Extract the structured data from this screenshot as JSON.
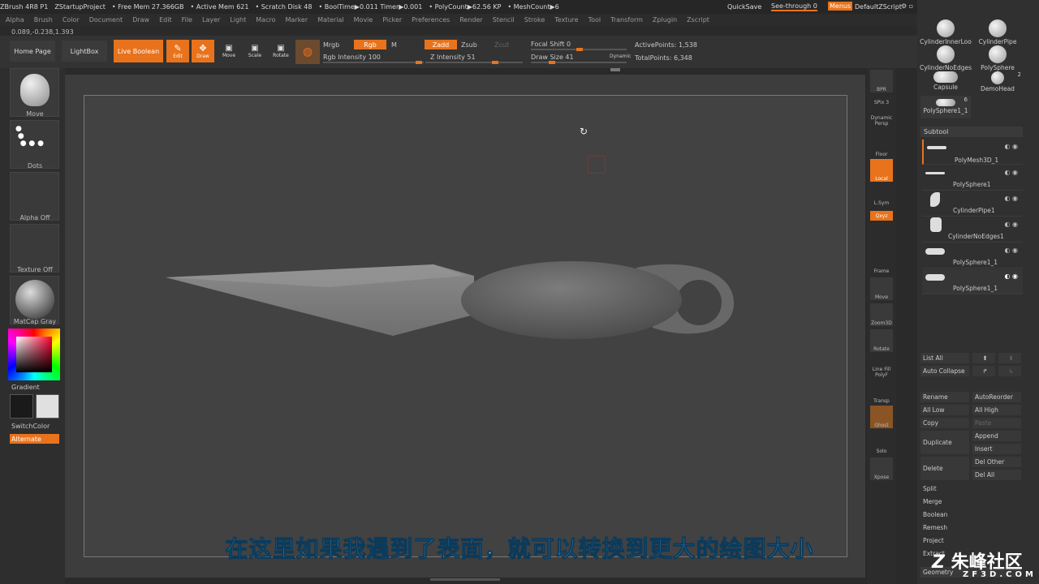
{
  "titlebar": {
    "items": [
      "ZBrush 4R8 P1",
      "ZStartupProject",
      "• Free Mem 27.366GB",
      "• Active Mem 621",
      "• Scratch Disk 48",
      "• BoolTime▶0.011 Timer▶0.001",
      "• PolyCount▶62.56 KP",
      "• MeshCount▶6"
    ],
    "quicksave": "QuickSave",
    "see_through": "See-through  0",
    "menus": "Menus",
    "script": "DefaultZScript"
  },
  "menubar": [
    "Alpha",
    "Brush",
    "Color",
    "Document",
    "Draw",
    "Edit",
    "File",
    "Layer",
    "Light",
    "Macro",
    "Marker",
    "Material",
    "Movie",
    "Picker",
    "Preferences",
    "Render",
    "Stencil",
    "Stroke",
    "Texture",
    "Tool",
    "Transform",
    "Zplugin",
    "Zscript"
  ],
  "coords": "0.089,-0.238,1.393",
  "toolbar": {
    "home": "Home Page",
    "lightbox": "LightBox",
    "live_boolean": "Live Boolean",
    "edit": "Edit",
    "draw": "Draw",
    "move": "Move",
    "scale": "Scale",
    "rotate": "Rotate",
    "mrgb": "Mrgb",
    "rgb": "Rgb",
    "m": "M",
    "rgb_intensity_label": "Rgb Intensity",
    "rgb_intensity": "100",
    "zadd": "Zadd",
    "zsub": "Zsub",
    "zcut": "Zcut",
    "z_intensity_label": "Z Intensity",
    "z_intensity": "51",
    "focal_shift_label": "Focal Shift",
    "focal_shift": "0",
    "draw_size_label": "Draw Size",
    "draw_size": "41",
    "dynamic": "Dynamic",
    "active_points": "ActivePoints: 1,538",
    "total_points": "TotalPoints: 6,348"
  },
  "left": {
    "brush": "Move",
    "stroke": "Dots",
    "alpha": "Alpha Off",
    "texture": "Texture Off",
    "material": "MatCap Gray",
    "gradient": "Gradient",
    "switchcolor": "SwitchColor",
    "alternate": "Alternate"
  },
  "shelf": [
    "BPR",
    "SPix 3",
    "Dynamic Persp",
    "Floor",
    "Local",
    "L.Sym",
    "Qxyz",
    "Frame",
    "Move",
    "Zoom3D",
    "Rotate",
    "Line Fill PolyF",
    "Transp",
    "Ghost",
    "Solo",
    "Xpose"
  ],
  "tools": [
    {
      "name": "CylinderInnerLoo"
    },
    {
      "name": "CylinderPipe"
    },
    {
      "name": "CylinderNoEdges"
    },
    {
      "name": "PolySphere"
    },
    {
      "name": "Capsule"
    },
    {
      "name": "DemoHead",
      "count": "2"
    },
    {
      "name": "PolySphere1_1",
      "count": "6"
    }
  ],
  "subtool_header": "Subtool",
  "subtools": [
    "PolyMesh3D_1",
    "PolySphere1",
    "CylinderPipe1",
    "CylinderNoEdges1",
    "PolySphere1_1",
    "PolySphere1_1"
  ],
  "subtool_actions": {
    "list_all": "List All",
    "auto_collapse": "Auto Collapse",
    "rename": "Rename",
    "auto_reorder": "AutoReorder",
    "all_low": "All Low",
    "all_high": "All High",
    "copy": "Copy",
    "paste": "Paste",
    "duplicate": "Duplicate",
    "append": "Append",
    "insert": "Insert",
    "delete": "Delete",
    "del_other": "Del Other",
    "del_all": "Del All",
    "split": "Split",
    "merge": "Merge",
    "boolean": "Boolean",
    "remesh": "Remesh",
    "project": "Project",
    "extract": "Extract",
    "geometry": "Geometry"
  },
  "subtitle": "在这里如果我遇到了表面，就可以转换到更大的绘图大小",
  "logo": {
    "brand": "朱峰社区",
    "site": "ZF3D.COM"
  },
  "colors": {
    "accent": "#e8731c",
    "subtitle": "#62b8ee"
  }
}
